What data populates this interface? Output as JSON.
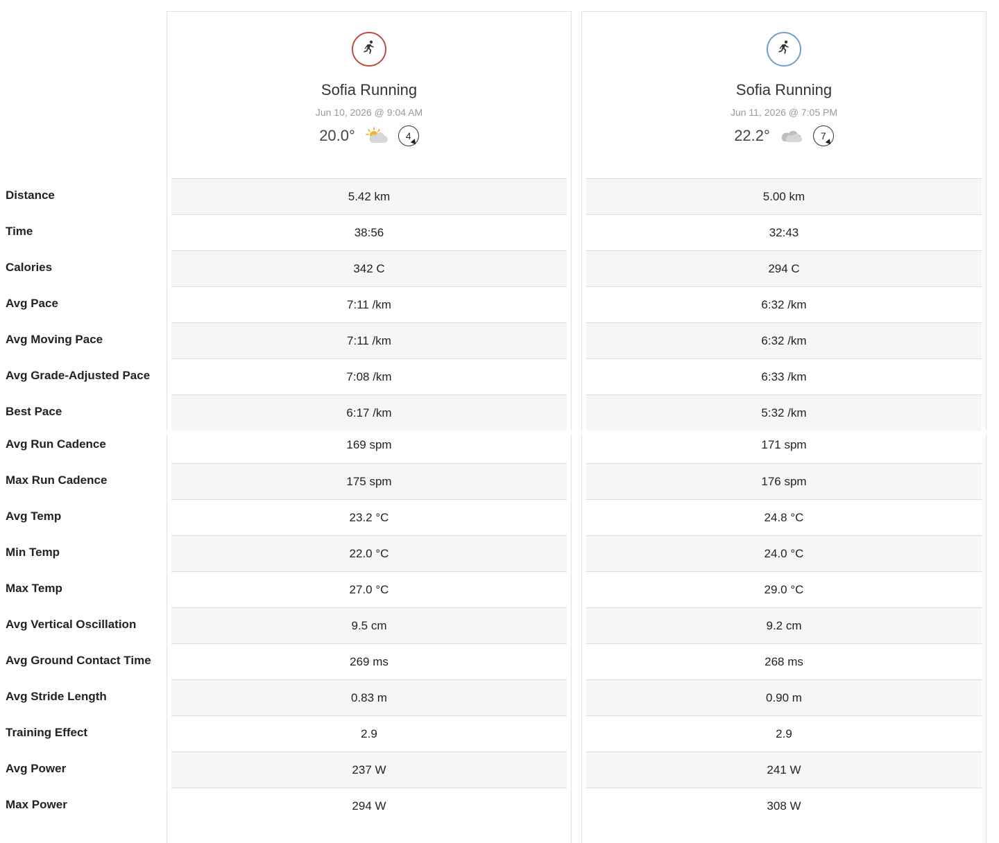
{
  "metric_labels": [
    "Distance",
    "Time",
    "Calories",
    "Avg Pace",
    "Avg Moving Pace",
    "Avg Grade-Adjusted Pace",
    "Best Pace",
    "Avg Run Cadence",
    "Max Run Cadence",
    "Avg Temp",
    "Min Temp",
    "Max Temp",
    "Avg Vertical Oscillation",
    "Avg Ground Contact Time",
    "Avg Stride Length",
    "Training Effect",
    "Avg Power",
    "Max Power"
  ],
  "activities": [
    {
      "name": "Sofia Running",
      "date": "Jun 10, 2026 @ 9:04 AM",
      "temperature": "20.0°",
      "weather_icon": "partly-sunny-icon",
      "wind": "4",
      "accent_color": "#c04a3d",
      "values": [
        "5.42 km",
        "38:56",
        "342 C",
        "7:11 /km",
        "7:11 /km",
        "7:08 /km",
        "6:17 /km",
        "169 spm",
        "175 spm",
        "23.2 °C",
        "22.0 °C",
        "27.0 °C",
        "9.5 cm",
        "269 ms",
        "0.83 m",
        "2.9",
        "237 W",
        "294 W"
      ]
    },
    {
      "name": "Sofia Running",
      "date": "Jun 11, 2026 @ 7:05 PM",
      "temperature": "22.2°",
      "weather_icon": "cloudy-icon",
      "wind": "7",
      "accent_color": "#6f9fd0",
      "values": [
        "5.00 km",
        "32:43",
        "294 C",
        "6:32 /km",
        "6:32 /km",
        "6:33 /km",
        "5:32 /km",
        "171 spm",
        "176 spm",
        "24.8 °C",
        "24.0 °C",
        "29.0 °C",
        "9.2 cm",
        "268 ms",
        "0.90 m",
        "2.9",
        "241 W",
        "308 W"
      ]
    }
  ]
}
